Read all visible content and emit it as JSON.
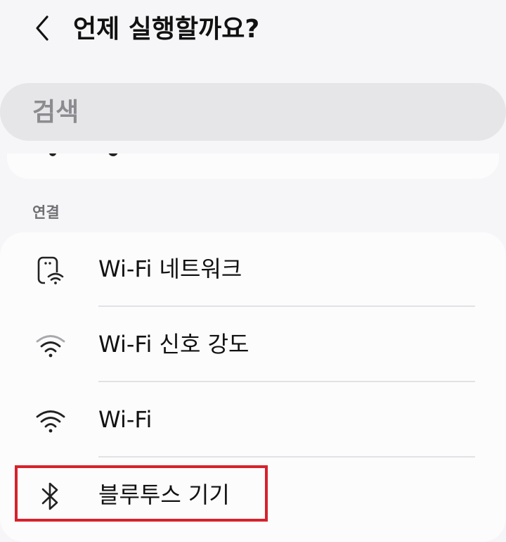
{
  "header": {
    "title": "언제 실행할까요?",
    "back_icon": "chevron-left-icon"
  },
  "search": {
    "placeholder": "검색"
  },
  "section": {
    "label": "연결"
  },
  "items": [
    {
      "label": "Wi-Fi 네트워크",
      "icon": "phone-wifi-icon"
    },
    {
      "label": "Wi-Fi 신호 강도",
      "icon": "wifi-signal-strength-icon"
    },
    {
      "label": "Wi-Fi",
      "icon": "wifi-icon"
    },
    {
      "label": "블루투스 기기",
      "icon": "bluetooth-icon"
    }
  ],
  "colors": {
    "background": "#f6f6f8",
    "card": "#fcfcfd",
    "search_bar": "#e6e6e9",
    "highlight": "#d7222c",
    "text_primary": "#111111",
    "text_secondary": "#707074"
  }
}
